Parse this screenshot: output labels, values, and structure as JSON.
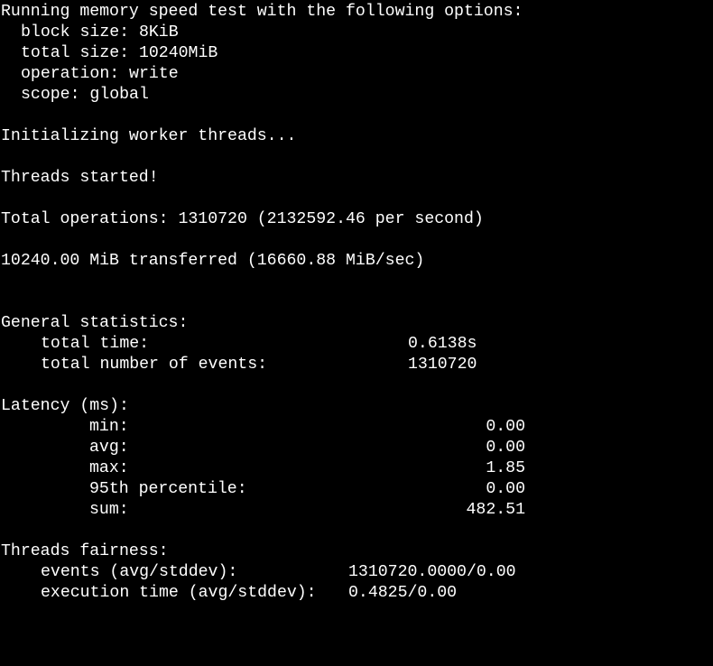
{
  "terminal": {
    "intro": {
      "heading": "Running memory speed test with the following options:",
      "options": [
        "block size: 8KiB",
        "total size: 10240MiB",
        "operation: write",
        "scope: global"
      ]
    },
    "init_message": "Initializing worker threads...",
    "started_message": "Threads started!",
    "total_operations": "Total operations: 1310720 (2132592.46 per second)",
    "transferred": "10240.00 MiB transferred (16660.88 MiB/sec)",
    "general": {
      "heading": "General statistics:",
      "rows": [
        {
          "label": "total time:",
          "value": "0.6138s"
        },
        {
          "label": "total number of events:",
          "value": "1310720"
        }
      ]
    },
    "latency": {
      "heading": "Latency (ms):",
      "rows": [
        {
          "label": "min:",
          "value": "0.00"
        },
        {
          "label": "avg:",
          "value": "0.00"
        },
        {
          "label": "max:",
          "value": "1.85"
        },
        {
          "label": "95th percentile:",
          "value": "0.00"
        },
        {
          "label": "sum:",
          "value": "482.51"
        }
      ]
    },
    "fairness": {
      "heading": "Threads fairness:",
      "rows": [
        {
          "label": "events (avg/stddev):",
          "value": "1310720.0000/0.00"
        },
        {
          "label": "execution time (avg/stddev):",
          "value": "0.4825/0.00"
        }
      ]
    }
  }
}
